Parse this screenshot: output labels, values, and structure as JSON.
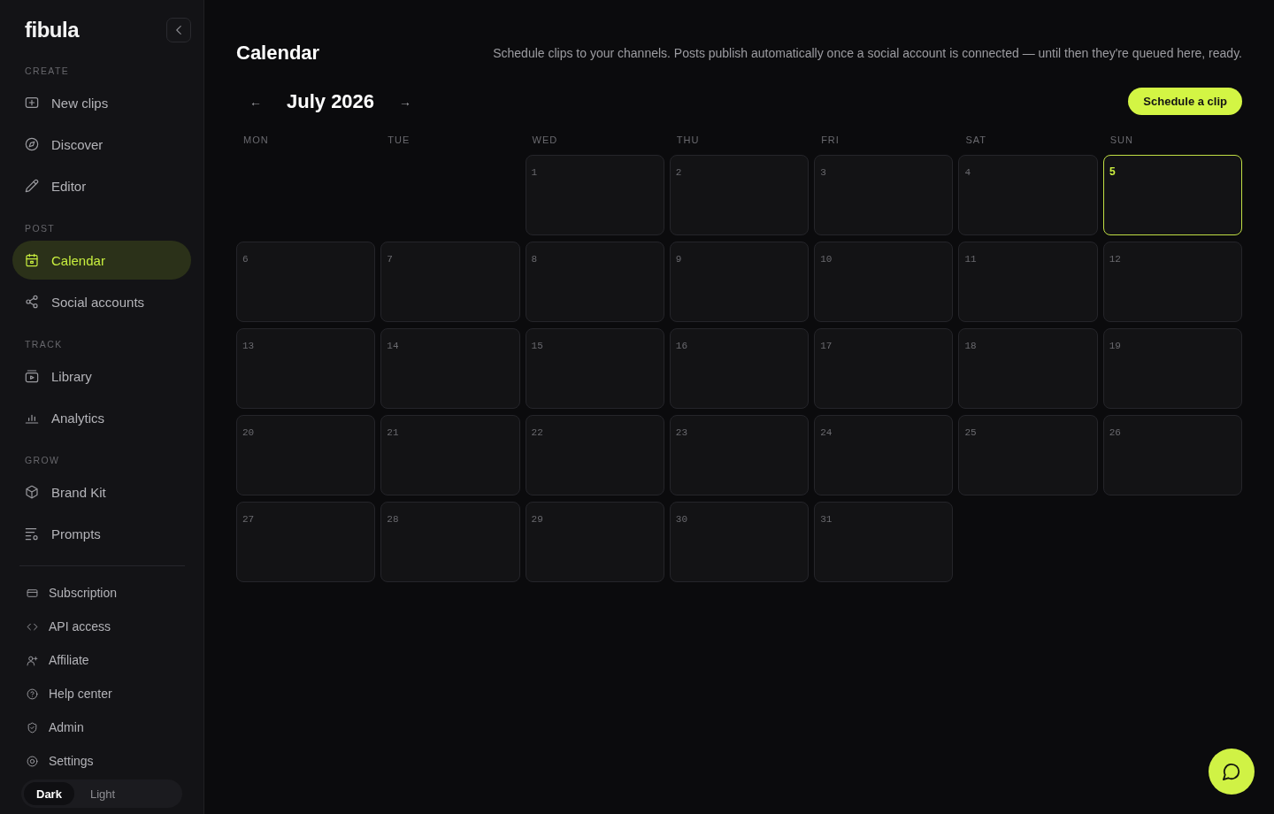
{
  "sidebar": {
    "logo": "fibula",
    "sections": [
      {
        "label": "CREATE",
        "items": [
          {
            "label": "New clips",
            "selected": false
          },
          {
            "label": "Discover",
            "selected": false
          },
          {
            "label": "Editor",
            "selected": false
          }
        ]
      },
      {
        "label": "POST",
        "items": [
          {
            "label": "Calendar",
            "selected": true
          },
          {
            "label": "Social accounts",
            "selected": false
          }
        ]
      },
      {
        "label": "TRACK",
        "items": [
          {
            "label": "Library",
            "selected": false
          },
          {
            "label": "Analytics",
            "selected": false
          }
        ]
      },
      {
        "label": "GROW",
        "items": [
          {
            "label": "Brand Kit",
            "selected": false
          },
          {
            "label": "Prompts",
            "selected": false
          }
        ]
      }
    ],
    "footer_links": [
      {
        "label": "Subscription"
      },
      {
        "label": "API access"
      },
      {
        "label": "Affiliate"
      },
      {
        "label": "Help center"
      },
      {
        "label": "Admin"
      },
      {
        "label": "Settings"
      }
    ],
    "theme_toggle": [
      {
        "label": "Dark",
        "selected": true
      },
      {
        "label": "Light",
        "selected": false
      }
    ]
  },
  "header": {
    "title": "Calendar",
    "description": "Schedule clips to your channels. Posts publish automatically once a social account is connected — until then they're queued here, ready."
  },
  "month_nav": {
    "prev": "←",
    "month": "July 2026",
    "next": "→"
  },
  "schedule_button": "Schedule a clip",
  "calendar": {
    "weekdays": [
      "MON",
      "TUE",
      "WED",
      "THU",
      "FRI",
      "SAT",
      "SUN"
    ],
    "cells": [
      {
        "kind": "blank"
      },
      {
        "kind": "blank"
      },
      {
        "kind": "day",
        "label": "1",
        "today": false
      },
      {
        "kind": "day",
        "label": "2",
        "today": false
      },
      {
        "kind": "day",
        "label": "3",
        "today": false
      },
      {
        "kind": "day",
        "label": "4",
        "today": false
      },
      {
        "kind": "day",
        "label": "5",
        "today": true
      },
      {
        "kind": "day",
        "label": "6",
        "today": false
      },
      {
        "kind": "day",
        "label": "7",
        "today": false
      },
      {
        "kind": "day",
        "label": "8",
        "today": false
      },
      {
        "kind": "day",
        "label": "9",
        "today": false
      },
      {
        "kind": "day",
        "label": "10",
        "today": false
      },
      {
        "kind": "day",
        "label": "11",
        "today": false
      },
      {
        "kind": "day",
        "label": "12",
        "today": false
      },
      {
        "kind": "day",
        "label": "13",
        "today": false
      },
      {
        "kind": "day",
        "label": "14",
        "today": false
      },
      {
        "kind": "day",
        "label": "15",
        "today": false
      },
      {
        "kind": "day",
        "label": "16",
        "today": false
      },
      {
        "kind": "day",
        "label": "17",
        "today": false
      },
      {
        "kind": "day",
        "label": "18",
        "today": false
      },
      {
        "kind": "day",
        "label": "19",
        "today": false
      },
      {
        "kind": "day",
        "label": "20",
        "today": false
      },
      {
        "kind": "day",
        "label": "21",
        "today": false
      },
      {
        "kind": "day",
        "label": "22",
        "today": false
      },
      {
        "kind": "day",
        "label": "23",
        "today": false
      },
      {
        "kind": "day",
        "label": "24",
        "today": false
      },
      {
        "kind": "day",
        "label": "25",
        "today": false
      },
      {
        "kind": "day",
        "label": "26",
        "today": false
      },
      {
        "kind": "day",
        "label": "27",
        "today": false
      },
      {
        "kind": "day",
        "label": "28",
        "today": false
      },
      {
        "kind": "day",
        "label": "29",
        "today": false
      },
      {
        "kind": "day",
        "label": "30",
        "today": false
      },
      {
        "kind": "day",
        "label": "31",
        "today": false
      }
    ]
  }
}
